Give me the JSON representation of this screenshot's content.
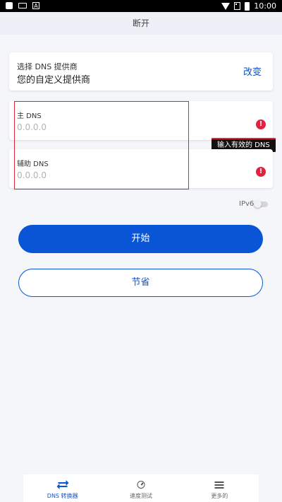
{
  "status_bar": {
    "time": "10:00",
    "app_icon_letter": "A"
  },
  "header": {
    "title": "断开"
  },
  "provider": {
    "label": "选择 DNS 提供商",
    "value": "您的自定义提供商",
    "change_label": "改变"
  },
  "primary_dns": {
    "label": "主 DNS",
    "placeholder": "0.0.0.0",
    "value": ""
  },
  "secondary_dns": {
    "label": "辅助 DNS",
    "placeholder": "0.0.0.0",
    "value": ""
  },
  "error": {
    "tooltip": "输入有效的 DNS",
    "icon_glyph": "!"
  },
  "ipv6": {
    "label": "IPv6",
    "enabled": false
  },
  "buttons": {
    "start_label": "开始",
    "save_label": "节省"
  },
  "bottom_nav": [
    {
      "label": "DNS 转换器",
      "icon": "transfer-icon",
      "active": true
    },
    {
      "label": "速度测试",
      "icon": "speed-gauge-icon",
      "active": false
    },
    {
      "label": "更多的",
      "icon": "menu-icon",
      "active": false
    }
  ],
  "colors": {
    "accent": "#0a55d6",
    "error": "#e4213e",
    "background": "#f5f6fa"
  }
}
